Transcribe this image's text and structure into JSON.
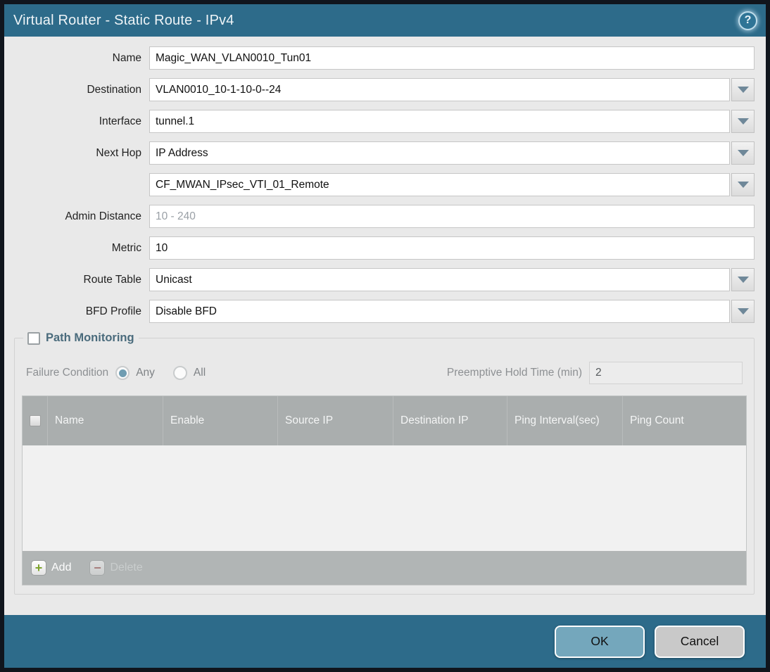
{
  "window": {
    "title": "Virtual Router - Static Route - IPv4",
    "help_icon": "question-mark-help"
  },
  "colors": {
    "titlebar_bg": "#2d6b8a",
    "content_bg": "#e9e9e9",
    "table_header_bg": "#aaaeae",
    "table_footer_bg": "#b1b5b5",
    "ok_button_bg": "#74a7bc",
    "cancel_button_bg": "#c9c9c9",
    "add_icon_green": "#7ea32d",
    "delete_icon_red": "#a0524f",
    "radio_selected_fill": "#6f9db2",
    "section_title_color": "#4a6b7c"
  },
  "form": {
    "name": {
      "label": "Name",
      "value": "Magic_WAN_VLAN0010_Tun01"
    },
    "destination": {
      "label": "Destination",
      "value": "VLAN0010_10-1-10-0--24"
    },
    "interface": {
      "label": "Interface",
      "value": "tunnel.1"
    },
    "next_hop": {
      "label": "Next Hop",
      "value": "IP Address"
    },
    "next_hop_address": {
      "value": "CF_MWAN_IPsec_VTI_01_Remote"
    },
    "admin_distance": {
      "label": "Admin Distance",
      "value": "",
      "placeholder": "10 - 240"
    },
    "metric": {
      "label": "Metric",
      "value": "10"
    },
    "route_table": {
      "label": "Route Table",
      "value": "Unicast"
    },
    "bfd_profile": {
      "label": "BFD Profile",
      "value": "Disable BFD"
    }
  },
  "path_monitoring": {
    "title": "Path Monitoring",
    "enabled_checkbox_checked": false,
    "failure_condition_label": "Failure Condition",
    "radio_any_label": "Any",
    "radio_all_label": "All",
    "failure_condition_selected": "Any",
    "preemptive_hold_label": "Preemptive Hold Time (min)",
    "preemptive_hold_value": "2",
    "table": {
      "columns": [
        "Name",
        "Enable",
        "Source IP",
        "Destination IP",
        "Ping Interval(sec)",
        "Ping Count"
      ],
      "rows": []
    },
    "add_label": "Add",
    "delete_label": "Delete",
    "delete_enabled": false
  },
  "footer": {
    "ok_label": "OK",
    "cancel_label": "Cancel"
  }
}
